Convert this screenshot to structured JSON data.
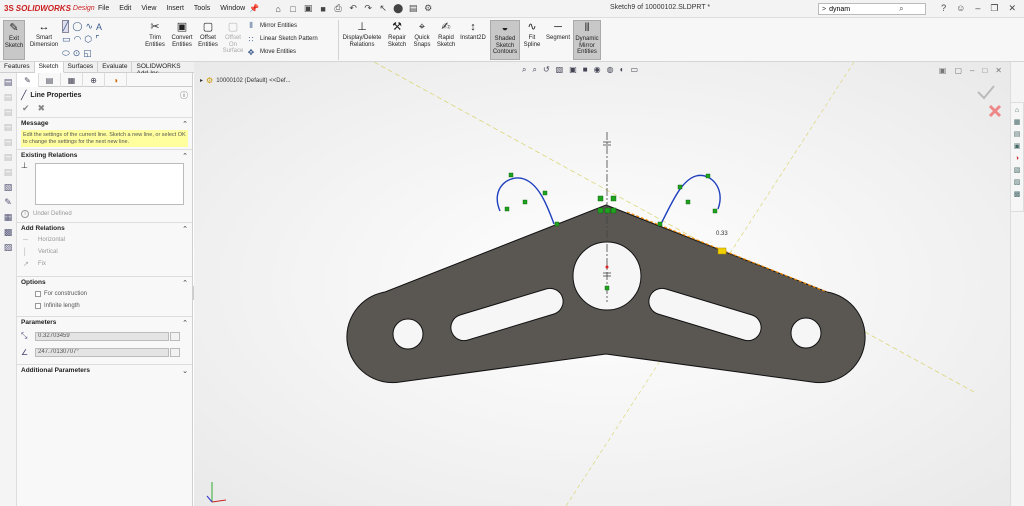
{
  "app": {
    "logo_ds": "3S",
    "logo_name": "SOLIDWORKS",
    "logo_suffix": "Design",
    "doc_title": "Sketch9 of 10000102.SLDPRT *"
  },
  "menus": [
    "File",
    "Edit",
    "View",
    "Insert",
    "Tools",
    "Window"
  ],
  "search": {
    "prompt": ">",
    "value": "dynam"
  },
  "ribbon": {
    "exit_sketch": "Exit\nSketch",
    "smart_dimension": "Smart\nDimension",
    "trim": "Trim\nEntities",
    "convert": "Convert\nEntities",
    "offset": "Offset\nEntities",
    "offset_surface": "Offset\nOn\nSurface",
    "mirror": "Mirror Entities",
    "linear_pattern": "Linear Sketch Pattern",
    "move": "Move Entities",
    "display_delete": "Display/Delete\nRelations",
    "repair": "Repair\nSketch",
    "quick_snaps": "Quick\nSnaps",
    "rapid_sketch": "Rapid\nSketch",
    "instant2d": "Instant2D",
    "shaded": "Shaded\nSketch\nContours",
    "fit_spline": "Fit\nSpline",
    "segment": "Segment",
    "dynamic_mirror": "Dynamic\nMirror\nEntities"
  },
  "command_tabs": [
    "Features",
    "Sketch",
    "Surfaces",
    "Evaluate",
    "SOLIDWORKS Add-Ins"
  ],
  "property_manager": {
    "title": "Line Properties",
    "message_header": "Message",
    "message": "Edit the settings of the current line. Sketch a new line, or select OK to change the settings for the next new line.",
    "existing_relations_header": "Existing Relations",
    "under_defined": "Under Defined",
    "add_relations_header": "Add Relations",
    "add_relations": [
      "Horizontal",
      "Vertical",
      "Fix"
    ],
    "options_header": "Options",
    "options": [
      "For construction",
      "Infinite length"
    ],
    "parameters_header": "Parameters",
    "length_value": "0.32703459",
    "angle_value": "247.70130707°",
    "additional_header": "Additional Parameters"
  },
  "viewport": {
    "tree_item": "10000102 (Default) <<Def...",
    "dim_text": "0.33"
  },
  "colors": {
    "brand": "#cc1f1f",
    "part_fill": "#5a5753",
    "sketch_blue": "#1f3fbf",
    "relation_green": "#1fa31f",
    "highlight_orange": "#f08a00",
    "message_bg": "#ffff9e"
  }
}
